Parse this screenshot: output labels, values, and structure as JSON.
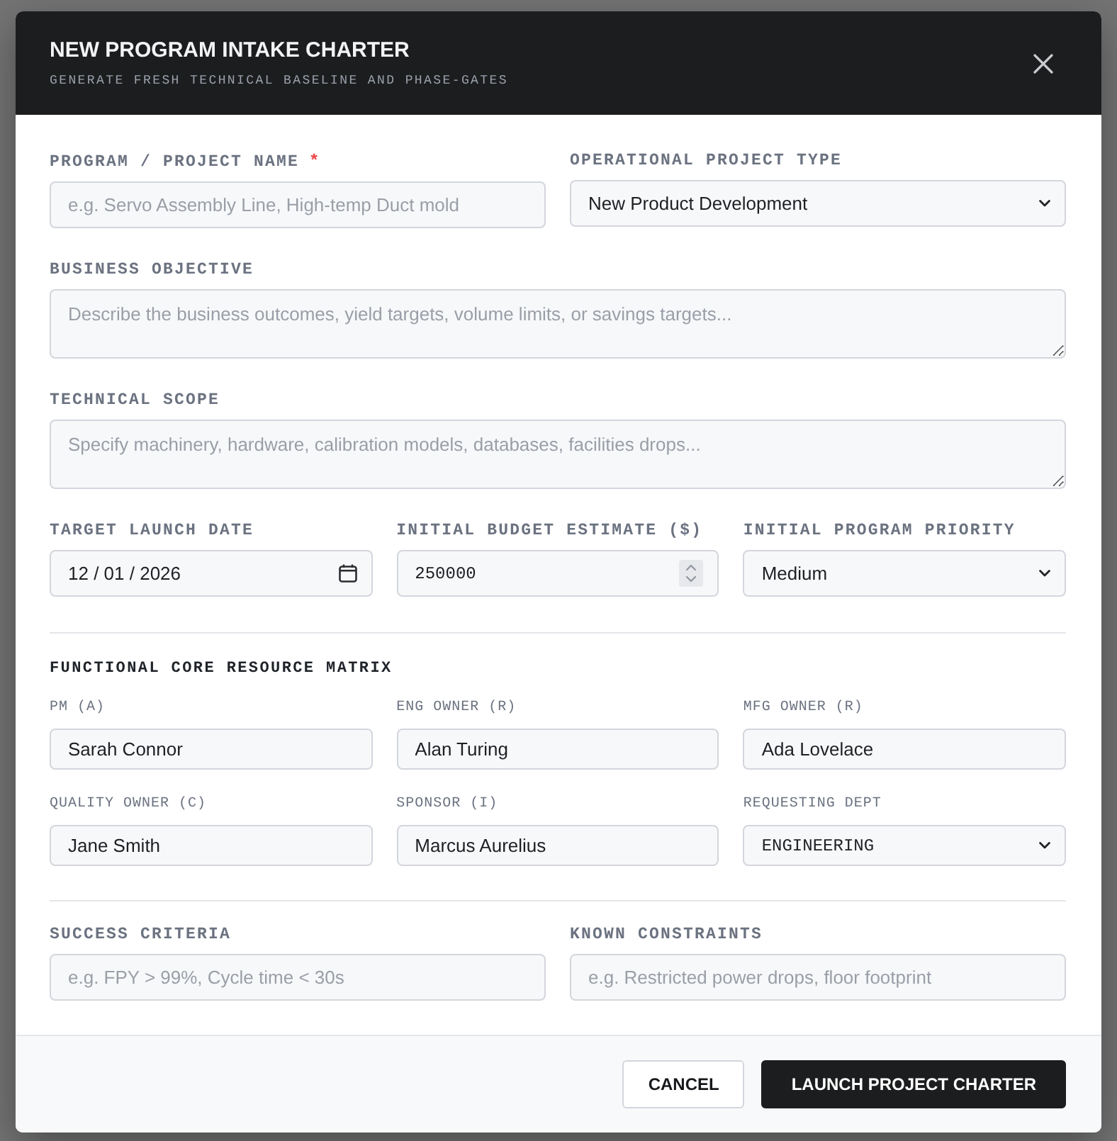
{
  "dialog": {
    "title": "NEW PROGRAM INTAKE CHARTER",
    "subtitle": "GENERATE FRESH TECHNICAL BASELINE AND PHASE-GATES"
  },
  "rows": [
    {
      "fields": [
        {
          "kind": "text",
          "label": "PROGRAM / PROJECT NAME",
          "required_mark": "*",
          "placeholder": "e.g. Servo Assembly Line, High-temp Duct mold"
        },
        {
          "kind": "select",
          "label": "OPERATIONAL PROJECT TYPE",
          "value": "New Product Development"
        }
      ]
    },
    {
      "fields": [
        {
          "kind": "textarea",
          "label": "BUSINESS OBJECTIVE",
          "placeholder": "Describe the business outcomes, yield targets, volume limits, or savings targets..."
        }
      ]
    },
    {
      "fields": [
        {
          "kind": "textarea",
          "label": "TECHNICAL SCOPE",
          "placeholder": "Specify machinery, hardware, calibration models, databases, facilities drops..."
        }
      ]
    },
    {
      "fields": [
        {
          "kind": "date",
          "label": "TARGET LAUNCH DATE",
          "value": "12 / 01 / 2026"
        },
        {
          "kind": "number",
          "label": "INITIAL BUDGET ESTIMATE ($)",
          "value": "250000"
        },
        {
          "kind": "select",
          "label": "INITIAL PROGRAM PRIORITY",
          "value": "Medium"
        }
      ]
    }
  ],
  "resource_matrix": {
    "title": "FUNCTIONAL CORE RESOURCE MATRIX",
    "fields": [
      {
        "kind": "text",
        "label": "PM (A)",
        "value": "Sarah Connor"
      },
      {
        "kind": "text",
        "label": "ENG OWNER (R)",
        "value": "Alan Turing"
      },
      {
        "kind": "text",
        "label": "MFG OWNER (R)",
        "value": "Ada Lovelace"
      },
      {
        "kind": "text",
        "label": "QUALITY OWNER (C)",
        "value": "Jane Smith"
      },
      {
        "kind": "text",
        "label": "SPONSOR (I)",
        "value": "Marcus Aurelius"
      },
      {
        "kind": "select",
        "label": "REQUESTING DEPT",
        "value": "ENGINEERING"
      }
    ]
  },
  "criteria": [
    {
      "kind": "text",
      "label": "SUCCESS CRITERIA",
      "placeholder": "e.g. FPY > 99%, Cycle time < 30s"
    },
    {
      "kind": "text",
      "label": "KNOWN CONSTRAINTS",
      "placeholder": "e.g. Restricted power drops, floor footprint"
    }
  ],
  "footer": {
    "buttons": [
      {
        "kind": "secondary",
        "label": "CANCEL"
      },
      {
        "kind": "primary",
        "label": "LAUNCH PROJECT CHARTER"
      }
    ]
  }
}
